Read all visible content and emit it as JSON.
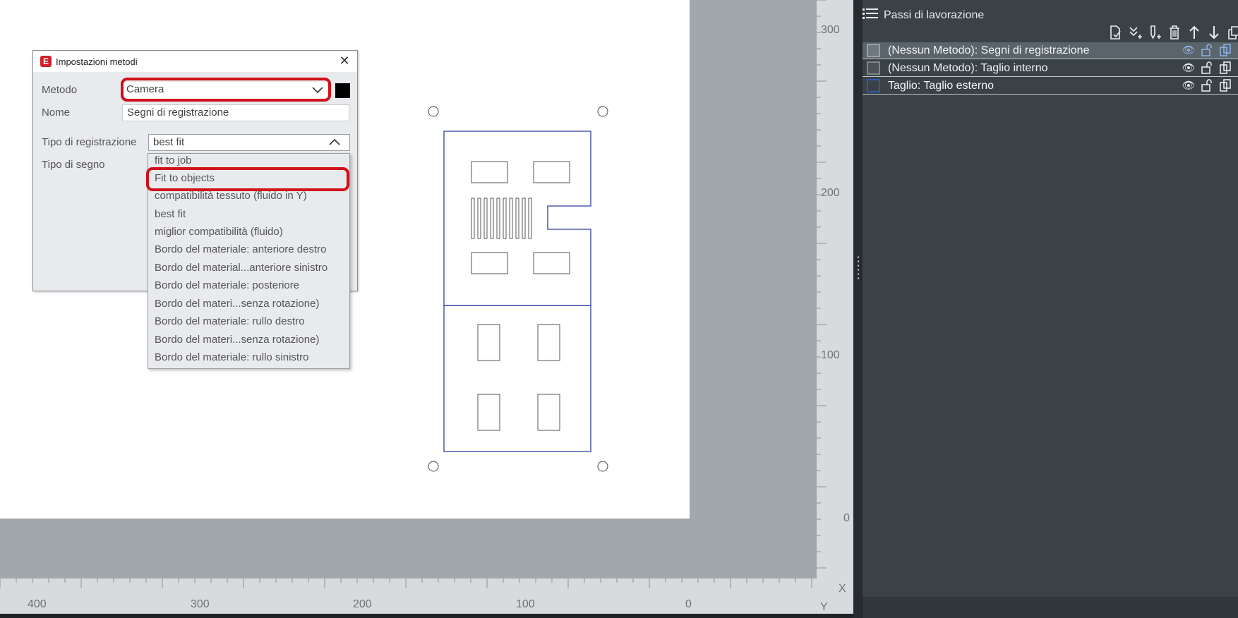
{
  "dialog": {
    "title": "Impostazioni metodi",
    "close_icon": "close-icon",
    "method_label": "Metodo",
    "method_value": "Camera",
    "name_label": "Nome",
    "name_value": "Segni di registrazione",
    "registration_type_label": "Tipo di registrazione",
    "registration_type_value": "best fit",
    "mark_type_label": "Tipo di segno",
    "swatch_color": "#000000"
  },
  "dropdown": {
    "options": [
      "fit to job",
      "Fit to objects",
      "compatibilità tessuto (fluido in Y)",
      "best fit",
      "miglior compatibilità (fluido)",
      "Bordo del materiale: anteriore destro",
      "Bordo del material...anteriore sinistro",
      "Bordo del materiale: posteriore",
      "Bordo del materi...senza rotazione)",
      "Bordo del materiale: rullo destro",
      "Bordo del materi...senza rotazione)",
      "Bordo del materiale: rullo sinistro"
    ],
    "highlighted": "Fit to objects"
  },
  "panel": {
    "title": "Passi di lavorazione",
    "toolbar": [
      "new-step-icon",
      "merge-down-icon",
      "add-pen-icon",
      "delete-icon",
      "move-up-icon",
      "move-down-icon",
      "copy-icon"
    ],
    "steps": [
      {
        "label": "(Nessun Metodo): Segni di registrazione",
        "selected": true
      },
      {
        "label": "(Nessun Metodo): Taglio interno",
        "selected": false
      },
      {
        "label": "Taglio: Taglio esterno",
        "selected": false
      }
    ]
  },
  "rulers": {
    "vertical_labels": [
      "300",
      "200",
      "100",
      "0"
    ],
    "horizontal_labels": [
      "400",
      "300",
      "200",
      "100",
      "0"
    ],
    "x_axis": "X",
    "y_axis": "Y"
  },
  "colors": {
    "accent_red": "#d0101a",
    "cut_line_blue": "#2e3f9e",
    "panel_bg": "#3b4247"
  }
}
